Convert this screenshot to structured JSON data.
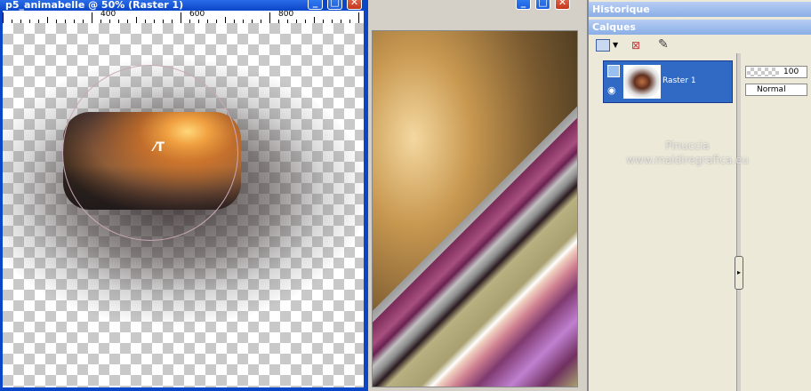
{
  "canvas_window": {
    "title": "p5_animabelle @ 50% (Raster 1)",
    "ruler_labels": [
      "400",
      "600",
      "800"
    ],
    "buttons": [
      "minimize",
      "maximize",
      "close"
    ]
  },
  "second_window": {
    "buttons": [
      "minimize",
      "maximize",
      "close"
    ]
  },
  "panels": {
    "historique": "Historique",
    "calques": "Calques"
  },
  "layers": {
    "items": [
      {
        "name": "Raster 1",
        "selected": true
      }
    ],
    "opacity": "100",
    "blend_mode": "Normal"
  },
  "watermark": {
    "line1": "Pinuccia",
    "line2": "www.maldiregrafica.eu"
  },
  "colors": {
    "titlebar": "#0a46c8",
    "panel_header": "#8aaee6",
    "layer_selected": "#316ac5",
    "stripe_purple": "#8a3a6a",
    "stripe_olive": "#a8a070"
  }
}
